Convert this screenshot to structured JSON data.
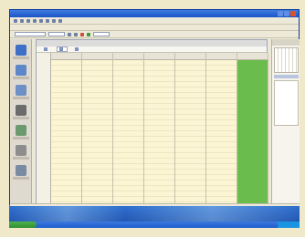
{
  "app": {
    "title": "",
    "menus": [],
    "views": {
      "active": "",
      "tabs": [
        "",
        "",
        ""
      ]
    }
  },
  "calendar": {
    "title": "",
    "days": [
      "",
      "",
      "",
      "",
      "",
      "",
      ""
    ],
    "time_labels": []
  },
  "colors": {
    "screen_blue": "#2c64b7",
    "day_cell": "#fbf5d3",
    "today_green": "#6abd4c",
    "start_button_green": "#3f9f3f"
  }
}
